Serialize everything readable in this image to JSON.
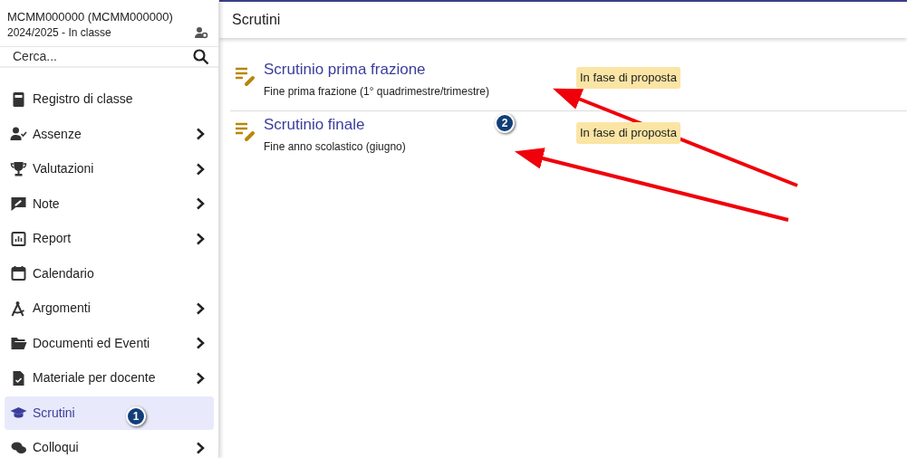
{
  "sidebar": {
    "school": "MCMM000000 (MCMM000000)",
    "class_info": "2024/2025 - In classe",
    "search": {
      "placeholder": "Cerca..."
    },
    "items": [
      {
        "label": "Registro di classe",
        "kind": "book",
        "expandable": false,
        "selected": false
      },
      {
        "label": "Assenze",
        "kind": "person-check",
        "expandable": true,
        "selected": false
      },
      {
        "label": "Valutazioni",
        "kind": "trophy",
        "expandable": true,
        "selected": false
      },
      {
        "label": "Note",
        "kind": "note",
        "expandable": true,
        "selected": false
      },
      {
        "label": "Report",
        "kind": "chart",
        "expandable": true,
        "selected": false
      },
      {
        "label": "Calendario",
        "kind": "calendar",
        "expandable": false,
        "selected": false
      },
      {
        "label": "Argomenti",
        "kind": "compass",
        "expandable": true,
        "selected": false
      },
      {
        "label": "Documenti ed Eventi",
        "kind": "folder",
        "expandable": true,
        "selected": false
      },
      {
        "label": "Materiale per docente",
        "kind": "document",
        "expandable": true,
        "selected": false
      },
      {
        "label": "Scrutini",
        "kind": "cap",
        "expandable": false,
        "selected": true
      },
      {
        "label": "Colloqui",
        "kind": "chat",
        "expandable": true,
        "selected": false
      }
    ]
  },
  "page": {
    "title": "Scrutini",
    "list": [
      {
        "title": "Scrutinio prima frazione",
        "subtitle": "Fine prima frazione (1° quadrimestre/trimestre)",
        "status": "In fase di proposta"
      },
      {
        "title": "Scrutinio finale",
        "subtitle": "Fine anno scolastico (giugno)",
        "status": "In fase di proposta"
      }
    ]
  },
  "annotations": [
    {
      "number": "1"
    },
    {
      "number": "2"
    }
  ]
}
